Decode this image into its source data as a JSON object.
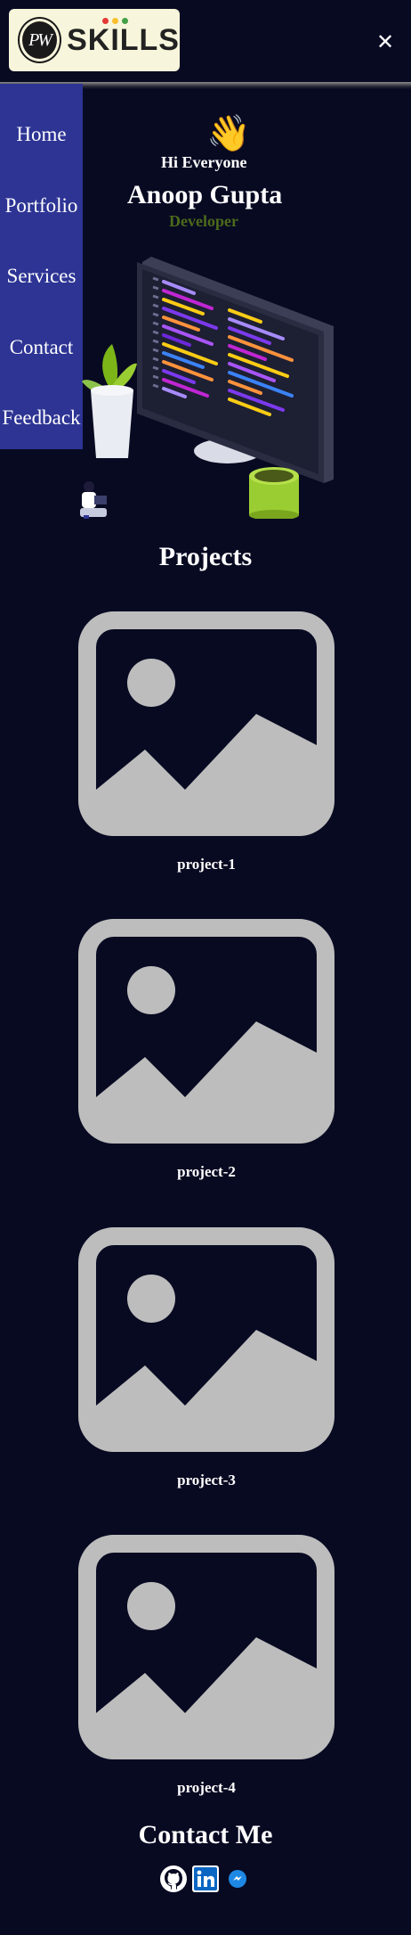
{
  "header": {
    "logo_text": "SKILLS",
    "logo_monogram": "PW",
    "close_icon": "close-icon"
  },
  "sidebar": {
    "items": [
      {
        "label": "Home"
      },
      {
        "label": "Portfolio"
      },
      {
        "label": "Services"
      },
      {
        "label": "Contact"
      },
      {
        "label": "Feedback"
      }
    ]
  },
  "hero": {
    "wave_emoji": "👋",
    "greeting": "Hi Everyone",
    "name": "Anoop Gupta",
    "role": "Developer"
  },
  "projects": {
    "title": "Projects",
    "items": [
      {
        "label": "project-1",
        "icon": "image-placeholder-icon"
      },
      {
        "label": "project-2",
        "icon": "image-placeholder-icon"
      },
      {
        "label": "project-3",
        "icon": "image-placeholder-icon"
      },
      {
        "label": "project-4",
        "icon": "image-placeholder-icon"
      }
    ]
  },
  "contact": {
    "title": "Contact Me",
    "links": [
      {
        "icon": "github-icon"
      },
      {
        "icon": "linkedin-icon"
      },
      {
        "icon": "messenger-icon"
      }
    ]
  },
  "colors": {
    "background": "#080a22",
    "sidebar": "#2d3494",
    "role_text": "#4c6a1a",
    "placeholder": "#bdbdbd",
    "logo_bg": "#f7f6dc"
  }
}
